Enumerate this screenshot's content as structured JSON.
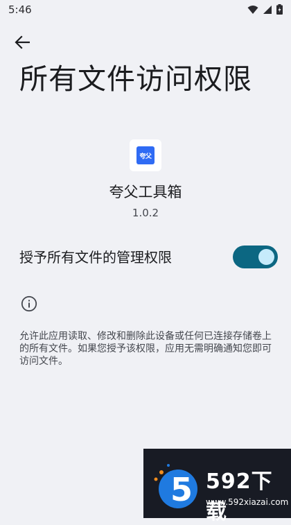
{
  "status_bar": {
    "time": "5:46",
    "icons": [
      "wifi-icon",
      "cellular-icon",
      "battery-icon"
    ]
  },
  "header": {
    "back_icon": "arrow-left-icon",
    "title": "所有文件访问权限"
  },
  "app": {
    "icon_text": "夸父",
    "name": "夸父工具箱",
    "version": "1.0.2"
  },
  "setting": {
    "label": "授予所有文件的管理权限",
    "enabled": true
  },
  "info": {
    "icon": "info-icon",
    "description": "允许此应用读取、修改和删除此设备或任何已连接存储卷上的所有文件。如果您授予该权限，应用无需明确通知您即可访问文件。"
  },
  "watermark": {
    "brand": "592下载",
    "url": "www.592xiazai.com",
    "logo_digit": "5"
  },
  "colors": {
    "background": "#f0f1f5",
    "toggle_track": "#0c6782",
    "toggle_thumb": "#c6ebfb",
    "app_icon": "#2f6bf4"
  }
}
